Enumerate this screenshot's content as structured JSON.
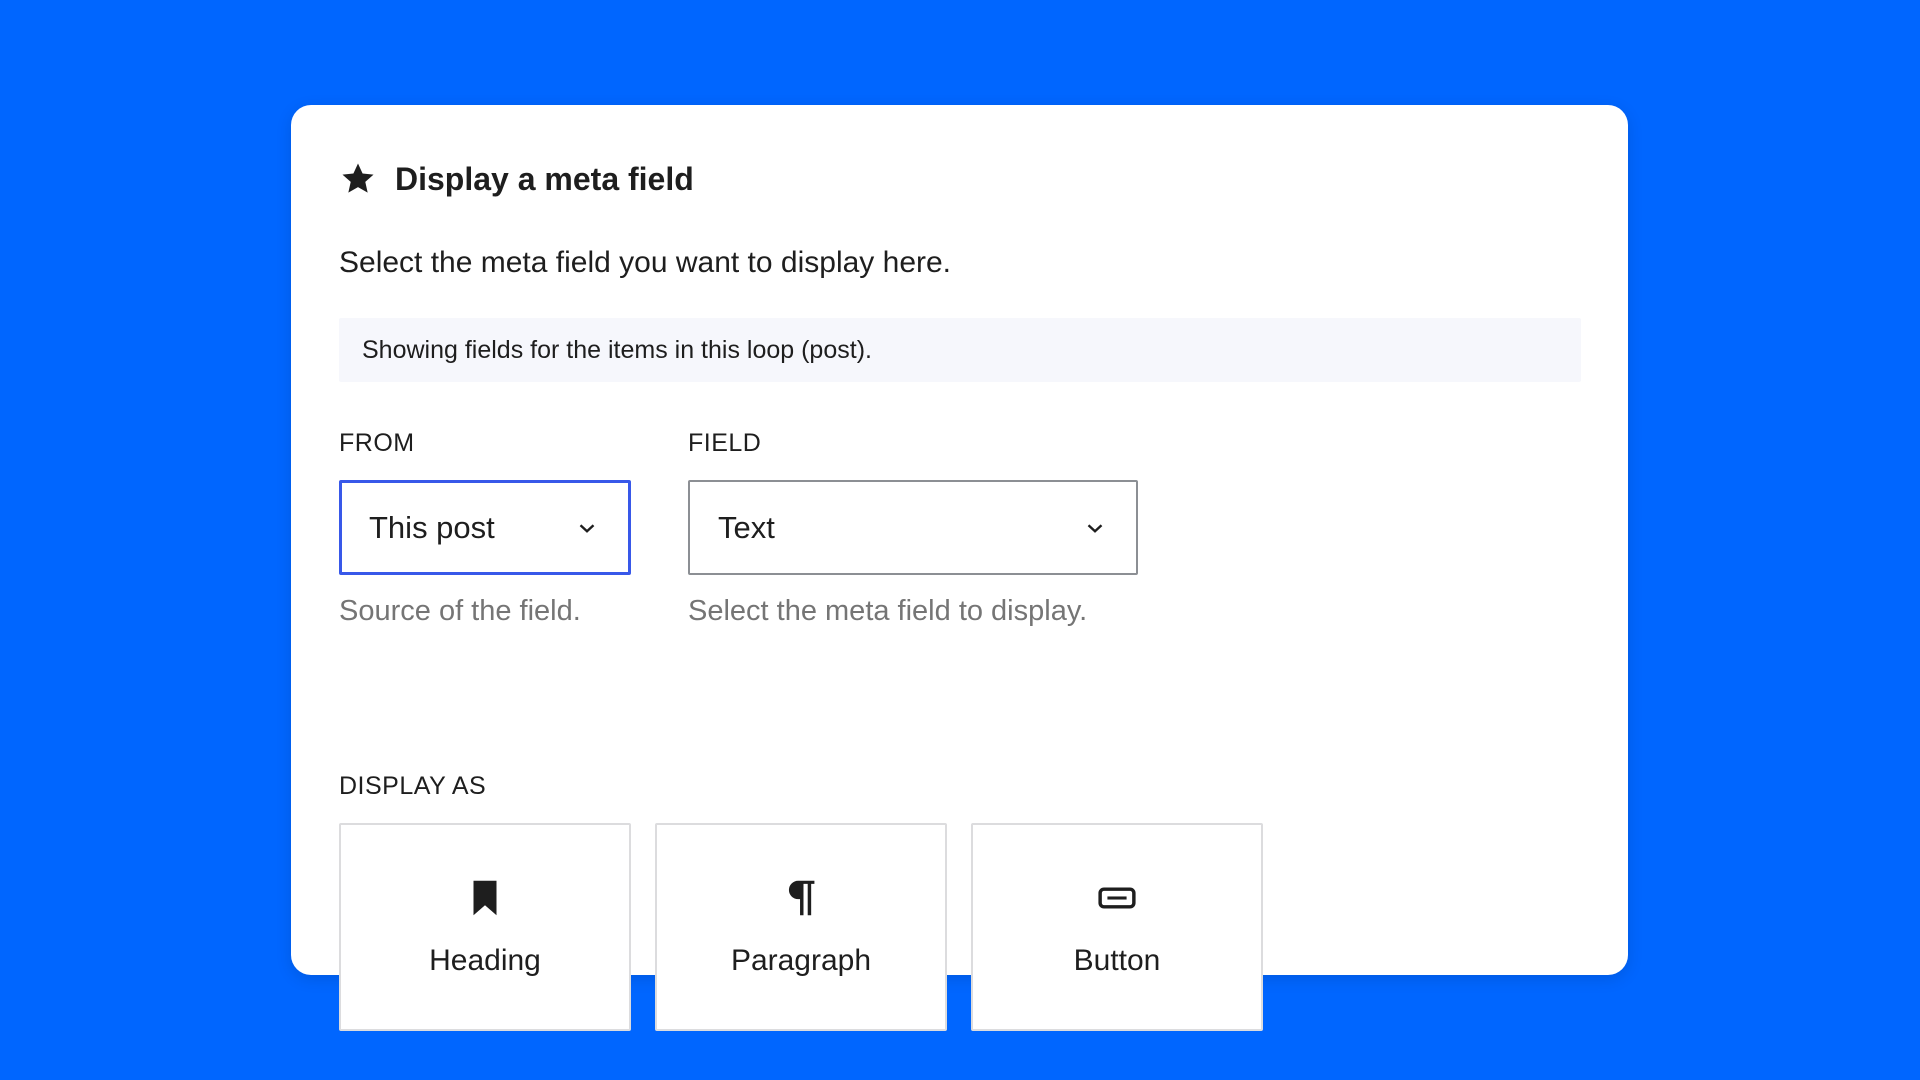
{
  "colors": {
    "background": "#0066ff",
    "card": "#ffffff",
    "focus_border": "#3858e9",
    "notice_bg": "#f6f7fc",
    "help_text": "#757575"
  },
  "header": {
    "icon": "star-icon",
    "title": "Display a meta field"
  },
  "instructions": "Select the meta field you want to display here.",
  "notice": "Showing fields for the items in this loop (post).",
  "from": {
    "label": "FROM",
    "value": "This post",
    "help": "Source of the field.",
    "focused": true
  },
  "field": {
    "label": "FIELD",
    "value": "Text",
    "help": "Select the meta field to display."
  },
  "display_as": {
    "label": "DISPLAY AS",
    "options": [
      {
        "label": "Heading",
        "icon": "bookmark-icon"
      },
      {
        "label": "Paragraph",
        "icon": "paragraph-icon"
      },
      {
        "label": "Button",
        "icon": "button-icon"
      }
    ]
  }
}
